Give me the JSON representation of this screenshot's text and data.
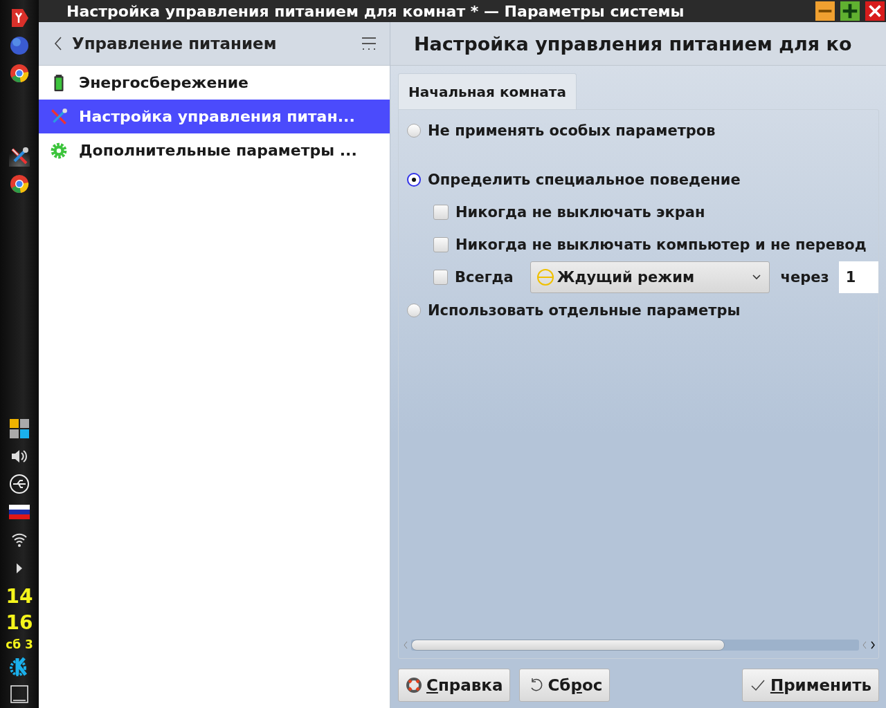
{
  "dock": {
    "hours": "14",
    "minutes": "16",
    "date": "сб 3"
  },
  "window": {
    "title": "Настройка управления питанием для комнат * — Параметры системы"
  },
  "sidebar": {
    "title": "Управление питанием",
    "items": [
      {
        "label": "Энергосбережение",
        "selected": false,
        "kind": "battery"
      },
      {
        "label": "Настройка управления питан...",
        "selected": true,
        "kind": "tools"
      },
      {
        "label": "Дополнительные параметры ...",
        "selected": false,
        "kind": "gear"
      }
    ]
  },
  "page": {
    "title": "Настройка управления питанием для ко"
  },
  "tabs": [
    {
      "label": "Начальная комната",
      "selected": true
    }
  ],
  "options": [
    {
      "label": "Не применять особых параметров",
      "selected": false
    },
    {
      "label": "Определить специальное поведение",
      "selected": true,
      "children": [
        {
          "kind": "check",
          "label": "Никогда не выключать экран",
          "checked": false
        },
        {
          "kind": "check",
          "label": "Никогда не выключать компьютер и не перевод",
          "checked": false
        },
        {
          "kind": "combo",
          "label": "Всегда",
          "checked": false,
          "action": "Ждущий режим",
          "after": "через",
          "value": "1"
        }
      ]
    },
    {
      "label": "Использовать отдельные параметры",
      "selected": false
    }
  ],
  "buttons": [
    {
      "kind": "help",
      "key": "С",
      "rest": "правка"
    },
    {
      "kind": "reset",
      "before": "Сб",
      "key": "р",
      "rest": "ос"
    },
    {
      "kind": "apply",
      "key": "П",
      "rest": "рименить"
    }
  ]
}
